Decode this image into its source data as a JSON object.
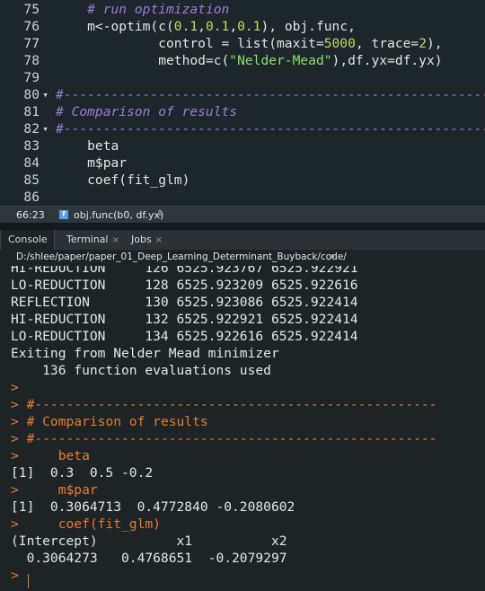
{
  "editor": {
    "lines": [
      {
        "n": "75",
        "fold": "",
        "parts": [
          {
            "t": "    ",
            "c": ""
          },
          {
            "t": "# run optimization",
            "c": "c-comment"
          }
        ]
      },
      {
        "n": "76",
        "fold": "",
        "parts": [
          {
            "t": "    m<-optim(c(",
            "c": ""
          },
          {
            "t": "0.1",
            "c": "c-num"
          },
          {
            "t": ",",
            "c": ""
          },
          {
            "t": "0.1",
            "c": "c-num"
          },
          {
            "t": ",",
            "c": ""
          },
          {
            "t": "0.1",
            "c": "c-num"
          },
          {
            "t": "), obj.func,",
            "c": ""
          }
        ]
      },
      {
        "n": "77",
        "fold": "",
        "parts": [
          {
            "t": "             control = list(maxit=",
            "c": ""
          },
          {
            "t": "5000",
            "c": "c-num"
          },
          {
            "t": ", trace=",
            "c": ""
          },
          {
            "t": "2",
            "c": "c-num"
          },
          {
            "t": "),",
            "c": ""
          }
        ]
      },
      {
        "n": "78",
        "fold": "",
        "parts": [
          {
            "t": "             method=c(",
            "c": ""
          },
          {
            "t": "\"Nelder-Mead\"",
            "c": "c-str"
          },
          {
            "t": "),df.yx=df.yx)",
            "c": ""
          }
        ]
      },
      {
        "n": "79",
        "fold": "",
        "parts": []
      },
      {
        "n": "80",
        "fold": "▾",
        "parts": [
          {
            "t": "#------------------------------------------------------------",
            "c": "c-comment"
          }
        ]
      },
      {
        "n": "81",
        "fold": "",
        "parts": [
          {
            "t": "# Comparison of results",
            "c": "c-comment"
          }
        ]
      },
      {
        "n": "82",
        "fold": "▾",
        "parts": [
          {
            "t": "#------------------------------------------------------------",
            "c": "c-comment"
          }
        ]
      },
      {
        "n": "83",
        "fold": "",
        "parts": [
          {
            "t": "    beta",
            "c": ""
          }
        ]
      },
      {
        "n": "84",
        "fold": "",
        "parts": [
          {
            "t": "    m$par",
            "c": ""
          }
        ]
      },
      {
        "n": "85",
        "fold": "",
        "parts": [
          {
            "t": "    coef(fit_glm)",
            "c": ""
          }
        ]
      },
      {
        "n": "86",
        "fold": "",
        "parts": []
      }
    ]
  },
  "status": {
    "position": "66:23",
    "function_badge": "f",
    "function_name": "obj.func(b0, df.yx)",
    "function_arrow": "⇕"
  },
  "tabs": [
    {
      "label": "Console",
      "close": ""
    },
    {
      "label": "Terminal",
      "close": "×"
    },
    {
      "label": "Jobs",
      "close": "×"
    }
  ],
  "path": {
    "text": "D:/shlee/paper/paper_01_Deep_Learning_Determinant_Buyback/code/",
    "icon": "↗"
  },
  "console": {
    "lines": [
      {
        "parts": [
          {
            "t": "HI-REDUCTION     126 6525.923767 6525.922921",
            "c": ""
          }
        ]
      },
      {
        "parts": [
          {
            "t": "LO-REDUCTION     128 6525.923209 6525.922616",
            "c": ""
          }
        ]
      },
      {
        "parts": [
          {
            "t": "REFLECTION       130 6525.923086 6525.922414",
            "c": ""
          }
        ]
      },
      {
        "parts": [
          {
            "t": "HI-REDUCTION     132 6525.922921 6525.922414",
            "c": ""
          }
        ]
      },
      {
        "parts": [
          {
            "t": "LO-REDUCTION     134 6525.922616 6525.922414",
            "c": ""
          }
        ]
      },
      {
        "parts": [
          {
            "t": "Exiting from Nelder Mead minimizer",
            "c": ""
          }
        ]
      },
      {
        "parts": [
          {
            "t": "    136 function evaluations used",
            "c": ""
          }
        ]
      },
      {
        "parts": [
          {
            "t": ">",
            "c": "k-prompt"
          }
        ]
      },
      {
        "parts": [
          {
            "t": "> ",
            "c": "k-prompt"
          },
          {
            "t": "#---------------------------------------------------",
            "c": "k-cmd"
          }
        ]
      },
      {
        "parts": [
          {
            "t": "> ",
            "c": "k-prompt"
          },
          {
            "t": "# Comparison of results",
            "c": "k-cmd"
          }
        ]
      },
      {
        "parts": [
          {
            "t": "> ",
            "c": "k-prompt"
          },
          {
            "t": "#---------------------------------------------------",
            "c": "k-cmd"
          }
        ]
      },
      {
        "parts": [
          {
            "t": ">     ",
            "c": "k-prompt"
          },
          {
            "t": "beta",
            "c": "k-cmd"
          }
        ]
      },
      {
        "parts": [
          {
            "t": "[1]  0.3  0.5 -0.2",
            "c": ""
          }
        ]
      },
      {
        "parts": [
          {
            "t": ">     ",
            "c": "k-prompt"
          },
          {
            "t": "m$par",
            "c": "k-cmd"
          }
        ]
      },
      {
        "parts": [
          {
            "t": "[1]  0.3064713  0.4772840 -0.2080602",
            "c": ""
          }
        ]
      },
      {
        "parts": [
          {
            "t": ">     ",
            "c": "k-prompt"
          },
          {
            "t": "coef(fit_glm)",
            "c": "k-cmd"
          }
        ]
      },
      {
        "parts": [
          {
            "t": "(Intercept)          x1          x2",
            "c": ""
          }
        ]
      },
      {
        "parts": [
          {
            "t": "  0.3064273   0.4768651  -0.2079297",
            "c": ""
          }
        ]
      },
      {
        "parts": [
          {
            "t": ">",
            "c": "k-prompt"
          }
        ]
      }
    ]
  },
  "colors": {
    "editor_bg": "#1d262b",
    "console_bg": "#1e2426",
    "comment": "#9a7fd8",
    "number": "#c5d967",
    "string": "#8fe06a",
    "prompt": "#e97b2f"
  }
}
